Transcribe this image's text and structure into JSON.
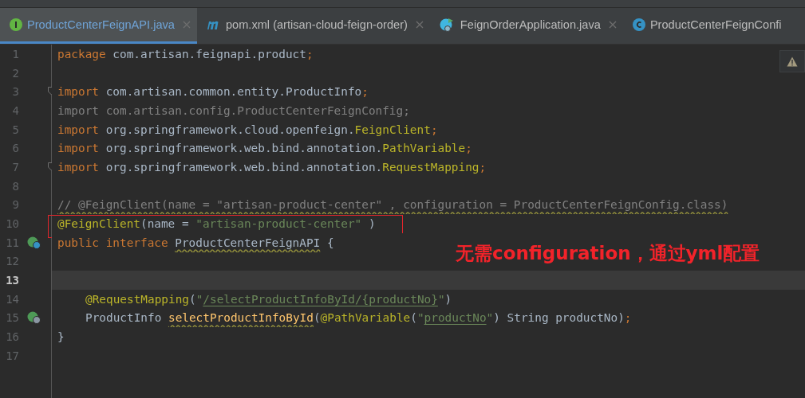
{
  "tabs": [
    {
      "label": "ProductCenterFeignAPI.java",
      "kind": "interface",
      "selected": true,
      "closable": true
    },
    {
      "label": "pom.xml (artisan-cloud-feign-order)",
      "kind": "maven",
      "selected": false,
      "closable": true
    },
    {
      "label": "FeignOrderApplication.java",
      "kind": "app",
      "selected": false,
      "closable": true
    },
    {
      "label": "ProductCenterFeignConfi",
      "kind": "class",
      "selected": false,
      "closable": false
    }
  ],
  "editor": {
    "lines": [
      {
        "number": "1",
        "kind": "plain",
        "current": false,
        "boxed": false,
        "fold": false,
        "tokens": [
          {
            "text": "package ",
            "kind": "keyword"
          },
          {
            "text": "com.artisan.feignapi.product",
            "kind": "plain"
          },
          {
            "text": ";",
            "kind": "punct"
          }
        ]
      },
      {
        "number": "2",
        "kind": "plain",
        "current": false,
        "boxed": false,
        "fold": false
      },
      {
        "number": "3",
        "kind": "plain",
        "current": false,
        "boxed": false,
        "fold": true,
        "tokens": [
          {
            "text": "import ",
            "kind": "keyword"
          },
          {
            "text": "com.artisan.common.entity.ProductInfo",
            "kind": "plain"
          },
          {
            "text": ";",
            "kind": "punct"
          }
        ]
      },
      {
        "number": "4",
        "kind": "plain",
        "current": false,
        "boxed": false,
        "fold": false,
        "tokens": [
          {
            "text": "import com.artisan.config.ProductCenterFeignConfig;",
            "kind": "unused"
          }
        ]
      },
      {
        "number": "5",
        "kind": "plain",
        "current": false,
        "boxed": false,
        "fold": false,
        "tokens": [
          {
            "text": "import ",
            "kind": "keyword"
          },
          {
            "text": "org.springframework.cloud.openfeign.",
            "kind": "plain"
          },
          {
            "text": "FeignClient",
            "kind": "annotation"
          },
          {
            "text": ";",
            "kind": "punct"
          }
        ]
      },
      {
        "number": "6",
        "kind": "plain",
        "current": false,
        "boxed": false,
        "fold": false,
        "tokens": [
          {
            "text": "import ",
            "kind": "keyword"
          },
          {
            "text": "org.springframework.web.bind.annotation.",
            "kind": "plain"
          },
          {
            "text": "PathVariable",
            "kind": "annotation"
          },
          {
            "text": ";",
            "kind": "punct"
          }
        ]
      },
      {
        "number": "7",
        "kind": "plain",
        "current": false,
        "boxed": false,
        "fold": true,
        "tokens": [
          {
            "text": "import ",
            "kind": "keyword"
          },
          {
            "text": "org.springframework.web.bind.annotation.",
            "kind": "plain"
          },
          {
            "text": "RequestMapping",
            "kind": "annotation"
          },
          {
            "text": ";",
            "kind": "punct"
          }
        ]
      },
      {
        "number": "8",
        "kind": "plain",
        "current": false,
        "boxed": false,
        "fold": false
      },
      {
        "number": "9",
        "kind": "plain",
        "current": false,
        "boxed": false,
        "fold": false,
        "tokens": [
          {
            "text": "// @FeignClient(name = \"artisan-product-center\" , configuration = ProductCenterFeignConfig.class)",
            "kind": "comment"
          }
        ]
      },
      {
        "number": "10",
        "kind": "plain",
        "current": false,
        "boxed": true,
        "fold": false,
        "tokens": [
          {
            "text": "@FeignClient",
            "kind": "annotation"
          },
          {
            "text": "(name = ",
            "kind": "plain"
          },
          {
            "text": "\"artisan-product-center\"",
            "kind": "string"
          },
          {
            "text": " )",
            "kind": "plain"
          }
        ]
      },
      {
        "number": "11",
        "kind": "implemented",
        "current": false,
        "boxed": false,
        "fold": false,
        "tokens": [
          {
            "text": "public interface ",
            "kind": "keyword"
          },
          {
            "text": "ProductCenterFeignAPI",
            "kind": "declaration"
          },
          {
            "text": " {",
            "kind": "plain"
          }
        ]
      },
      {
        "number": "12",
        "kind": "plain",
        "current": false,
        "boxed": false,
        "fold": false
      },
      {
        "number": "13",
        "kind": "plain",
        "current": true,
        "boxed": false,
        "fold": false
      },
      {
        "number": "14",
        "kind": "member",
        "current": false,
        "boxed": false,
        "fold": false,
        "tokens": [
          {
            "text": "@RequestMapping",
            "kind": "annotation"
          },
          {
            "text": "(",
            "kind": "plain"
          },
          {
            "text": "\"",
            "kind": "string"
          },
          {
            "text": "/selectProductInfoById/{productNo}",
            "kind": "link"
          },
          {
            "text": "\"",
            "kind": "string"
          },
          {
            "text": ")",
            "kind": "plain"
          }
        ]
      },
      {
        "number": "15",
        "kind": "implemented-member",
        "current": false,
        "boxed": false,
        "fold": false,
        "tokens": [
          {
            "text": "ProductInfo ",
            "kind": "plain"
          },
          {
            "text": "selectProductInfoById",
            "kind": "method"
          },
          {
            "text": "(",
            "kind": "plain"
          },
          {
            "text": "@PathVariable",
            "kind": "annotation"
          },
          {
            "text": "(",
            "kind": "plain"
          },
          {
            "text": "\"",
            "kind": "string"
          },
          {
            "text": "productNo",
            "kind": "link"
          },
          {
            "text": "\"",
            "kind": "string"
          },
          {
            "text": ") String productNo)",
            "kind": "plain"
          },
          {
            "text": ";",
            "kind": "punct"
          }
        ]
      },
      {
        "number": "16",
        "kind": "plain",
        "current": false,
        "boxed": false,
        "fold": false,
        "tokens": [
          {
            "text": "}",
            "kind": "plain"
          }
        ]
      },
      {
        "number": "17",
        "kind": "plain",
        "current": false,
        "boxed": false,
        "fold": false
      }
    ]
  },
  "callout": {
    "text": "无需configuration，通过yml配置"
  }
}
